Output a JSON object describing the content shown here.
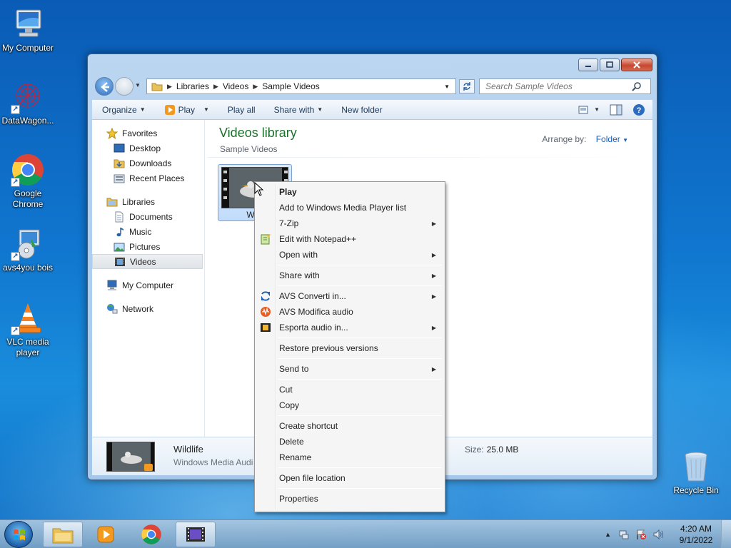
{
  "desktop": {
    "icons": [
      {
        "label": "My Computer"
      },
      {
        "label": "DataWagon..."
      },
      {
        "label": "Google Chrome"
      },
      {
        "label": "avs4you bois"
      },
      {
        "label": "VLC media player"
      },
      {
        "label": "Recycle Bin"
      }
    ]
  },
  "explorer": {
    "breadcrumb": [
      "Libraries",
      "Videos",
      "Sample Videos"
    ],
    "search_placeholder": "Search Sample Videos",
    "toolbar": {
      "organize": "Organize",
      "play": "Play",
      "play_all": "Play all",
      "share_with": "Share with",
      "new_folder": "New folder"
    },
    "nav": {
      "favorites": "Favorites",
      "desktop": "Desktop",
      "downloads": "Downloads",
      "recent_places": "Recent Places",
      "libraries": "Libraries",
      "documents": "Documents",
      "music": "Music",
      "pictures": "Pictures",
      "videos": "Videos",
      "my_computer": "My Computer",
      "network": "Network"
    },
    "library_title": "Videos library",
    "library_sub": "Sample Videos",
    "arrange_label": "Arrange by:",
    "arrange_value": "Folder",
    "file": {
      "label": "Wild"
    },
    "details": {
      "name": "Wildlife",
      "type": "Windows Media Audi",
      "size_label": "Size:",
      "size_value": "25.0 MB"
    }
  },
  "context_menu": {
    "play": "Play",
    "add_wmp": "Add to Windows Media Player list",
    "zip": "7-Zip",
    "notepad": "Edit with Notepad++",
    "open_with": "Open with",
    "share_with": "Share with",
    "avs_converti": "AVS Converti in...",
    "avs_modifica": "AVS Modifica audio",
    "esporta": "Esporta audio in...",
    "restore": "Restore previous versions",
    "send_to": "Send to",
    "cut": "Cut",
    "copy": "Copy",
    "create_shortcut": "Create shortcut",
    "delete": "Delete",
    "rename": "Rename",
    "open_location": "Open file location",
    "properties": "Properties"
  },
  "taskbar": {
    "time": "4:20 AM",
    "date": "9/1/2022"
  },
  "colors": {
    "library_title": "#1e6e2d",
    "link_blue": "#1d5fb8",
    "desktop_blue": "#1076cf"
  }
}
